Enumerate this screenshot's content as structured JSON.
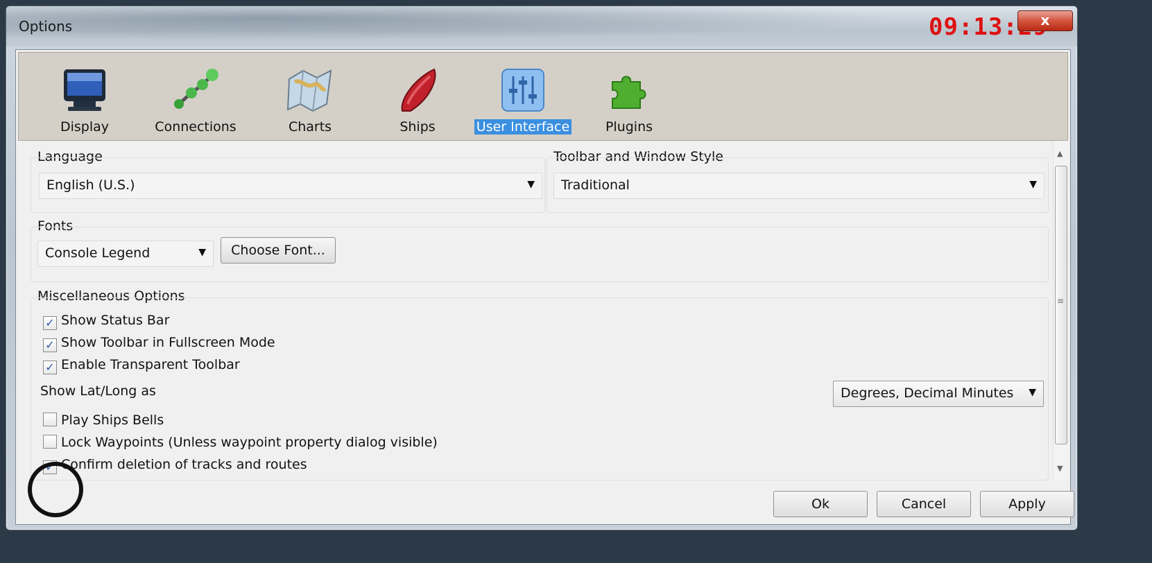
{
  "window": {
    "title": "Options",
    "clock": "09:13:29",
    "close_label": "x"
  },
  "toolbar": {
    "items": [
      {
        "label": "Display",
        "icon": "monitor-icon"
      },
      {
        "label": "Connections",
        "icon": "connections-icon"
      },
      {
        "label": "Charts",
        "icon": "chart-map-icon"
      },
      {
        "label": "Ships",
        "icon": "ship-icon"
      },
      {
        "label": "User Interface",
        "icon": "sliders-icon",
        "selected": true
      },
      {
        "label": "Plugins",
        "icon": "puzzle-icon"
      }
    ]
  },
  "language": {
    "label": "Language",
    "value": "English (U.S.)"
  },
  "style": {
    "label": "Toolbar and Window Style",
    "value": "Traditional"
  },
  "fonts": {
    "label": "Fonts",
    "value": "Console Legend",
    "choose_label": "Choose Font..."
  },
  "misc": {
    "label": "Miscellaneous Options",
    "checkboxes": [
      {
        "label": "Show Status Bar",
        "checked": true
      },
      {
        "label": "Show Toolbar in Fullscreen Mode",
        "checked": true
      },
      {
        "label": "Enable Transparent Toolbar",
        "checked": true
      }
    ],
    "latlong_label": "Show Lat/Long as",
    "latlong_value": "Degrees, Decimal Minutes",
    "checkboxes2": [
      {
        "label": "Play Ships Bells",
        "checked": false
      },
      {
        "label": "Lock Waypoints (Unless waypoint property dialog visible)",
        "checked": false
      },
      {
        "label": "Confirm deletion of tracks and routes",
        "checked": true
      }
    ]
  },
  "buttons": {
    "ok": "Ok",
    "cancel": "Cancel",
    "apply": "Apply"
  },
  "colors": {
    "selected_tab": "#3b8fe0",
    "clock": "#dd1111",
    "check": "#2a53a8"
  }
}
